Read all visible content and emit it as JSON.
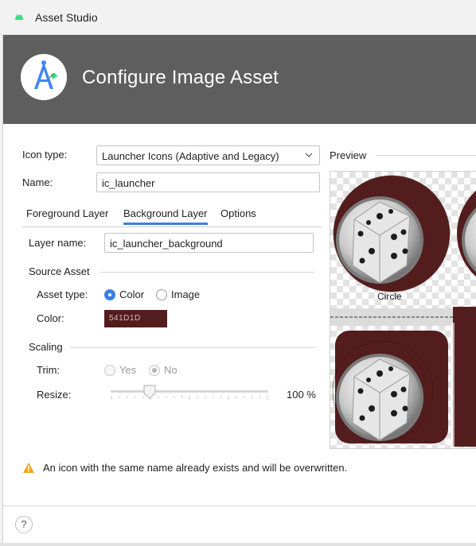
{
  "window": {
    "title": "Asset Studio",
    "app_icon": "android-icon"
  },
  "header": {
    "title": "Configure Image Asset",
    "logo": "android-studio-logo"
  },
  "form": {
    "icon_type_label": "Icon type:",
    "icon_type_value": "Launcher Icons (Adaptive and Legacy)",
    "name_label": "Name:",
    "name_value": "ic_launcher"
  },
  "tabs": [
    {
      "label": "Foreground Layer",
      "active": false
    },
    {
      "label": "Background Layer",
      "active": true
    },
    {
      "label": "Options",
      "active": false
    }
  ],
  "layer": {
    "layer_name_label": "Layer name:",
    "layer_name_value": "ic_launcher_background"
  },
  "source_asset": {
    "title": "Source Asset",
    "asset_type_label": "Asset type:",
    "options": [
      {
        "label": "Color",
        "checked": true
      },
      {
        "label": "Image",
        "checked": false
      }
    ],
    "color_label": "Color:",
    "color_value": "541D1D",
    "color_hex": "#541D1D"
  },
  "scaling": {
    "title": "Scaling",
    "trim_label": "Trim:",
    "trim_options": [
      {
        "label": "Yes",
        "checked": false
      },
      {
        "label": "No",
        "checked": true
      }
    ],
    "resize_label": "Resize:",
    "resize_value": "100 %",
    "resize_fraction": 0.25
  },
  "preview": {
    "title": "Preview",
    "captions": [
      "Circle"
    ]
  },
  "warning": {
    "icon": "warning-icon",
    "text": "An icon with the same name already exists and will be overwritten."
  },
  "footer": {
    "help_label": "?"
  },
  "colors": {
    "accent": "#3C80E2",
    "header_bg": "#5E5E5E",
    "icon_bg": "#541D1D",
    "warning": "#F2A51A"
  }
}
